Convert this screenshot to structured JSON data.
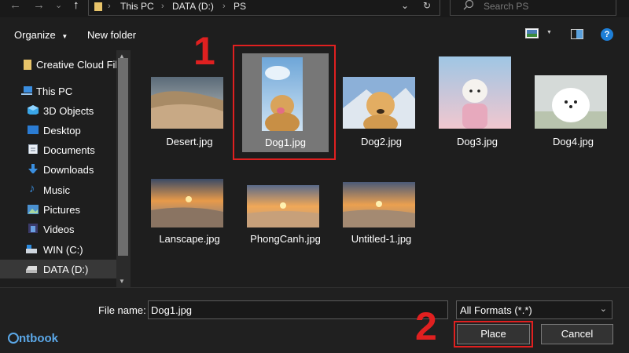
{
  "address_bar": {
    "back": "←",
    "forward": "→",
    "recent": "⌄",
    "up": "↑",
    "crumbs": [
      "This PC",
      "DATA (D:)",
      "PS"
    ],
    "separator": "›",
    "dropdown": "⌄",
    "refresh": "↻",
    "search_placeholder": "Search PS"
  },
  "toolbar": {
    "organize": "Organize",
    "new_folder": "New folder",
    "help": "?"
  },
  "sidebar": {
    "items": [
      {
        "label": "Creative Cloud File",
        "icon": "folder-icon"
      },
      {
        "label": "This PC",
        "icon": "computer-icon"
      },
      {
        "label": "3D Objects",
        "icon": "cube-icon"
      },
      {
        "label": "Desktop",
        "icon": "desktop-icon"
      },
      {
        "label": "Documents",
        "icon": "document-icon"
      },
      {
        "label": "Downloads",
        "icon": "download-icon"
      },
      {
        "label": "Music",
        "icon": "music-icon"
      },
      {
        "label": "Pictures",
        "icon": "pictures-icon"
      },
      {
        "label": "Videos",
        "icon": "video-icon"
      },
      {
        "label": "WIN (C:)",
        "icon": "drive-icon"
      },
      {
        "label": "DATA (D:)",
        "icon": "drive-icon"
      }
    ],
    "selected": "DATA (D:)"
  },
  "files": [
    {
      "name": "Desert.jpg",
      "kind": "desert"
    },
    {
      "name": "Dog1.jpg",
      "kind": "dog1",
      "selected": true
    },
    {
      "name": "Dog2.jpg",
      "kind": "dog2"
    },
    {
      "name": "Dog3.jpg",
      "kind": "dog3"
    },
    {
      "name": "Dog4.jpg",
      "kind": "dog4"
    },
    {
      "name": "Lanscape.jpg",
      "kind": "sunset"
    },
    {
      "name": "PhongCanh.jpg",
      "kind": "sunset2"
    },
    {
      "name": "Untitled-1.jpg",
      "kind": "sunset3"
    }
  ],
  "annotations": {
    "step1": "1",
    "step2": "2"
  },
  "footer": {
    "file_name_label": "File name:",
    "file_name_value": "Dog1.jpg",
    "format_value": "All Formats (*.*)",
    "format_chevron": "⌄",
    "place_label": "Place",
    "cancel_label": "Cancel",
    "logo_text": "ntbook"
  },
  "colors": {
    "annotation_red": "#e02020",
    "folder_yellow": "#e8c46a",
    "accent_blue": "#1e7fd8"
  }
}
